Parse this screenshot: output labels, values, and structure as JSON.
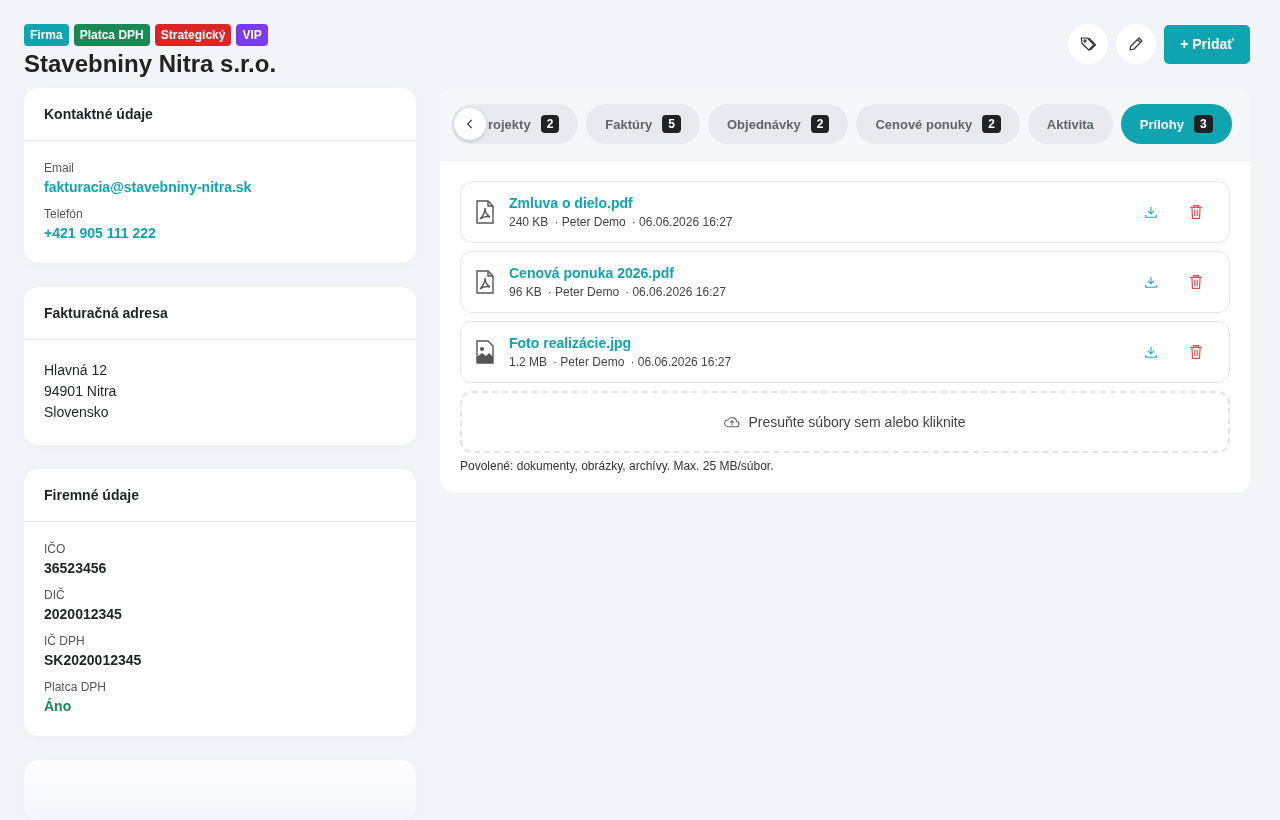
{
  "header": {
    "tags": [
      {
        "label": "Firma",
        "color": "#0ea5b0"
      },
      {
        "label": "Platca DPH",
        "color": "#1a8a55"
      },
      {
        "label": "Strategický",
        "color": "#dc2626"
      },
      {
        "label": "VIP",
        "color": "#7c3aed"
      }
    ],
    "title": "Stavebniny Nitra s.r.o.",
    "add_button": "+ Pridať"
  },
  "cards": [
    {
      "title": "Kontaktné údaje",
      "fields": [
        {
          "label": "Email",
          "value": "fakturacia@stavebniny-nitra.sk",
          "kind": "link"
        },
        {
          "label": "Telefón",
          "value": "+421 905 111 222",
          "kind": "link"
        }
      ]
    },
    {
      "title": "Fakturačná adresa",
      "lines": [
        "Hlavná 12",
        "94901 Nitra",
        "Slovensko"
      ]
    },
    {
      "title": "Firemné údaje",
      "fields": [
        {
          "label": "IČO",
          "value": "36523456",
          "kind": "strong"
        },
        {
          "label": "DIČ",
          "value": "2020012345",
          "kind": "strong"
        },
        {
          "label": "IČ DPH",
          "value": "SK2020012345",
          "kind": "strong"
        },
        {
          "label": "Platca DPH",
          "value": "Áno",
          "kind": "positive"
        }
      ]
    },
    {
      "kind": "faded"
    }
  ],
  "tabs": [
    {
      "label": "rojekty",
      "count": "2",
      "selected": false
    },
    {
      "label": "Faktúry",
      "count": "5",
      "selected": false
    },
    {
      "label": "Objednávky",
      "count": "2",
      "selected": false
    },
    {
      "label": "Cenové ponuky",
      "count": "2",
      "selected": false
    },
    {
      "label": "Aktivita",
      "selected": false
    },
    {
      "label": "Prílohy",
      "count": "3",
      "selected": true
    }
  ],
  "files": [
    {
      "name": "Zmluva o dielo.pdf",
      "kind": "pdf",
      "size": "240 KB",
      "author": "· Peter Demo",
      "date": "· 06.06.2026 16:27"
    },
    {
      "name": "Cenová ponuka 2026.pdf",
      "kind": "pdf",
      "size": "96 KB",
      "author": "· Peter Demo",
      "date": "· 06.06.2026 16:27"
    },
    {
      "name": "Foto realizácie.jpg",
      "kind": "image",
      "size": "1.2 MB",
      "author": "· Peter Demo",
      "date": "· 06.06.2026 16:27"
    }
  ],
  "dropzone": "Presuňte súbory sem alebo kliknite",
  "note": "Povolené: dokumenty, obrázky, archívy. Max. 25 MB/súbor."
}
